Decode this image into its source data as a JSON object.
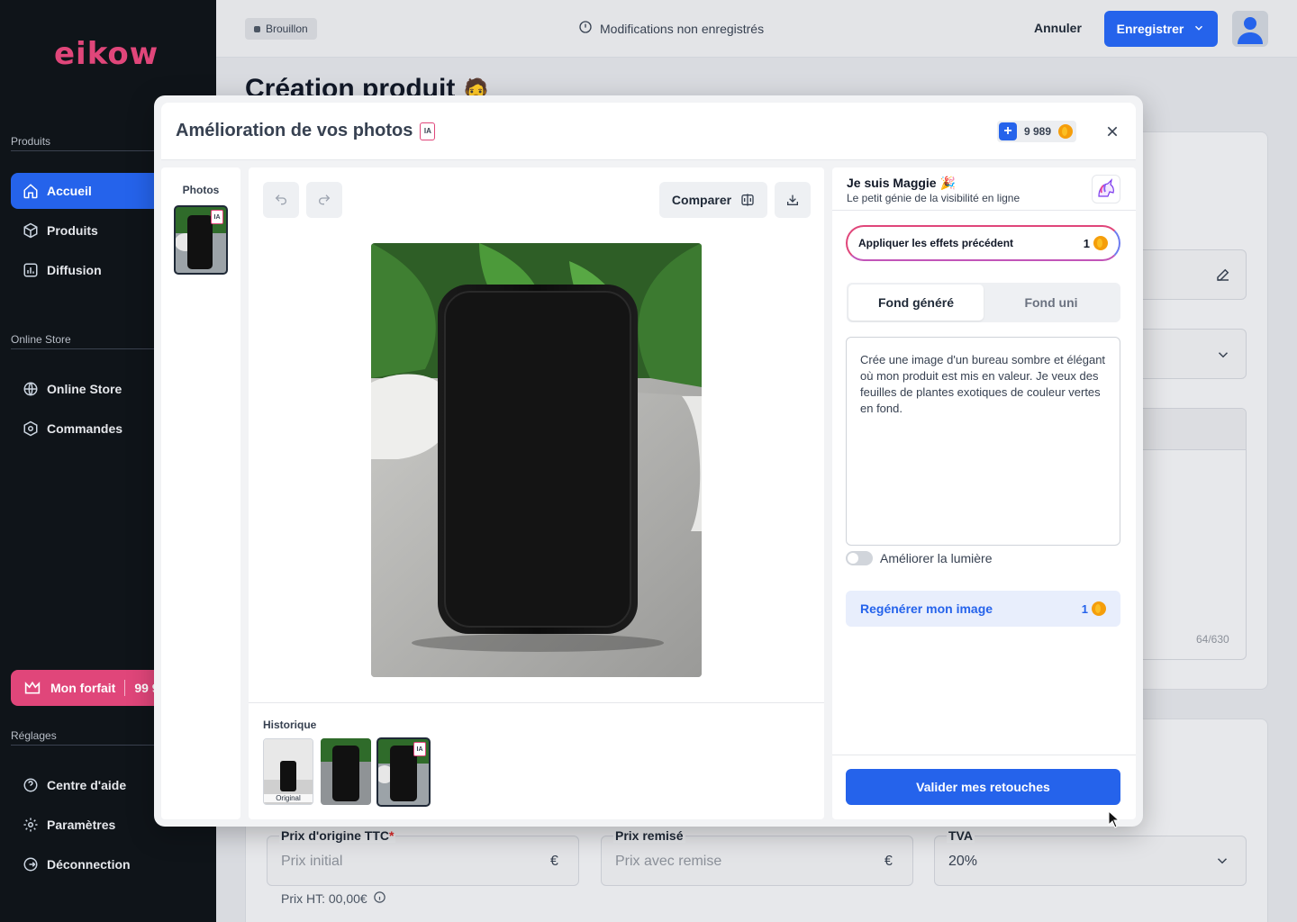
{
  "sidebar": {
    "logo": "eikow",
    "sections": {
      "produits": "Produits",
      "online_store": "Online Store",
      "reglages": "Réglages"
    },
    "items": [
      {
        "label": "Accueil"
      },
      {
        "label": "Produits"
      },
      {
        "label": "Diffusion"
      },
      {
        "label": "Online Store"
      },
      {
        "label": "Commandes"
      },
      {
        "label": "Centre d'aide"
      },
      {
        "label": "Paramètres"
      },
      {
        "label": "Déconnection"
      }
    ],
    "forfait": {
      "label": "Mon forfait",
      "value": "99 9"
    }
  },
  "topbar": {
    "status_badge": "Brouillon",
    "unsaved": "Modifications non enregistrés",
    "cancel": "Annuler",
    "save": "Enregistrer"
  },
  "page": {
    "title": "Création produit",
    "counter": "64/630",
    "price_original_label": "Prix d'origine TTC",
    "price_original_placeholder": "Prix initial",
    "price_discount_label": "Prix remisé",
    "price_discount_placeholder": "Prix avec remise",
    "currency": "€",
    "tva_label": "TVA",
    "tva_value": "20%",
    "prix_ht": "Prix HT: 00,00€"
  },
  "modal": {
    "title": "Amélioration de vos photos",
    "ia_tag": "IA",
    "credits": "9 989",
    "photos_label": "Photos",
    "compare": "Comparer",
    "history_label": "Historique",
    "original_label": "Original",
    "maggie": {
      "name": "Je suis Maggie",
      "subtitle": "Le petit génie de la visibilité en ligne"
    },
    "apply_previous": {
      "label": "Appliquer les effets précédent",
      "cost": "1"
    },
    "tabs": [
      {
        "label": "Fond généré"
      },
      {
        "label": "Fond uni"
      }
    ],
    "prompt": "Crée une image d'un bureau sombre et élégant où mon produit est mis en valeur. Je veux des feuilles de plantes exotiques de couleur vertes en fond.",
    "toggle_light": "Améliorer la lumière",
    "regenerate": {
      "label": "Regénérer mon image",
      "cost": "1"
    },
    "validate": "Valider mes retouches"
  },
  "colors": {
    "primary": "#2563eb",
    "brand_pink": "#e0467a",
    "sidebar_bg": "#0f1419"
  }
}
